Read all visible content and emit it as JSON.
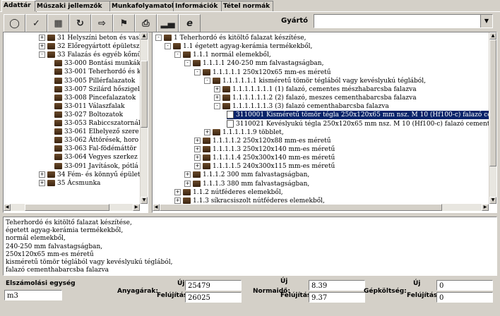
{
  "tabs": [
    "Adattár",
    "Műszaki jellemzők",
    "Munkafolyamatok",
    "Információk",
    "Tétel normák"
  ],
  "toolbar": {
    "icons": [
      "binoculars-icon",
      "checkmark-icon",
      "copy-tree-icon",
      "cycle-icon",
      "export-icon",
      "flag-icon",
      "print-icon",
      "chart-icon",
      "ec-icon"
    ]
  },
  "gyarto": {
    "label": "Gyártó",
    "value": ""
  },
  "left_tree": [
    "31 Helyszíni beton és vasbet",
    "32 Előregyártott épületszerk",
    "33 Falazás és egyéb kőműves",
    "33-000 Bontási munkák",
    "33-001 Teherhordó és k",
    "33-005 Pillérfalazatok",
    "33-007 Szilárd hőszigel",
    "33-008 Pincefalazatok",
    "33-011 Válaszfalak",
    "33-027 Boltozatok",
    "33-053 Rabiccszatornák",
    "33-061 Elhelyező szere",
    "33-062 Áttörések, horo",
    "33-063 Fal-födémáttör",
    "33-064 Vegyes szerkez",
    "33-091 Javítások, pótlá",
    "34 Fém- és könnyű épületsze",
    "35 Ácsmunka"
  ],
  "right_tree": [
    "1 Teherhordó és kitöltő falazat készítése,",
    "1.1 égetett agyag-kerámia termékekből,",
    "1.1.1 normál elemekből,",
    "1.1.1.1 240-250 mm falvastagságban,",
    "1.1.1.1.1 250x120x65 mm-es méretű",
    "1.1.1.1.1.1 kisméretű tömör téglából vagy kevéslyukú téglából,",
    "1.1.1.1.1.1.1 (1) falazó, cementes mészhabarcsba falazva",
    "1.1.1.1.1.1.2 (2) falazó, meszes cementhabarcsba falazva",
    "1.1.1.1.1.1.3 (3) falazó cementhabarcsba falazva",
    "3110001 Kisméretű tömör tégla 250x120x65 mm nsz. M 10 (Hf100-c) falazó ceme",
    "3110021 Kevéslyukú tégla 250x120x65 mm nsz. M 10 (Hf100-c) falazó cementhe",
    "1.1.1.1.1.9 többlet,",
    "1.1.1.1.2 250x120x88 mm-es méretű",
    "1.1.1.1.3 250x120x140 mm-es méretű",
    "1.1.1.1.4 250x300x140 mm-es méretű",
    "1.1.1.1.5 240x300x115 mm-es méretű",
    "1.1.1.2 300 mm falvastagságban,",
    "1.1.1.3 380 mm falvastagságban,",
    "1.1.2 nútféderes elemekből,",
    "1.1.3 síkracsiszolt nútféderes elemekből,"
  ],
  "description": [
    "Teherhordó és kitöltő falazat készítése,",
    "égetett agyag-kerámia termékekből,",
    "normál elemekből,",
    "240-250 mm falvastagságban,",
    "250x120x65 mm-es méretű",
    "kisméretű tömör téglából vagy kevéslyukú téglából,",
    "falazó cementhabarcsba falazva"
  ],
  "footer": {
    "unit_label": "Elszámolási egység",
    "unit_value": "m3",
    "anyagar_label": "Anyagárak:",
    "normaido_label": "Normaidő:",
    "gepkoltseg_label": "Gépköltség:",
    "uj_label": "Új",
    "feljitas_label": "Felújítás",
    "anyagar_uj": "25479",
    "anyagar_feljitas": "26025",
    "normaido_uj": "8.39",
    "normaido_feljitas": "9.37",
    "gepkoltseg_uj": "0",
    "gepkoltseg_feljitas": "0"
  }
}
